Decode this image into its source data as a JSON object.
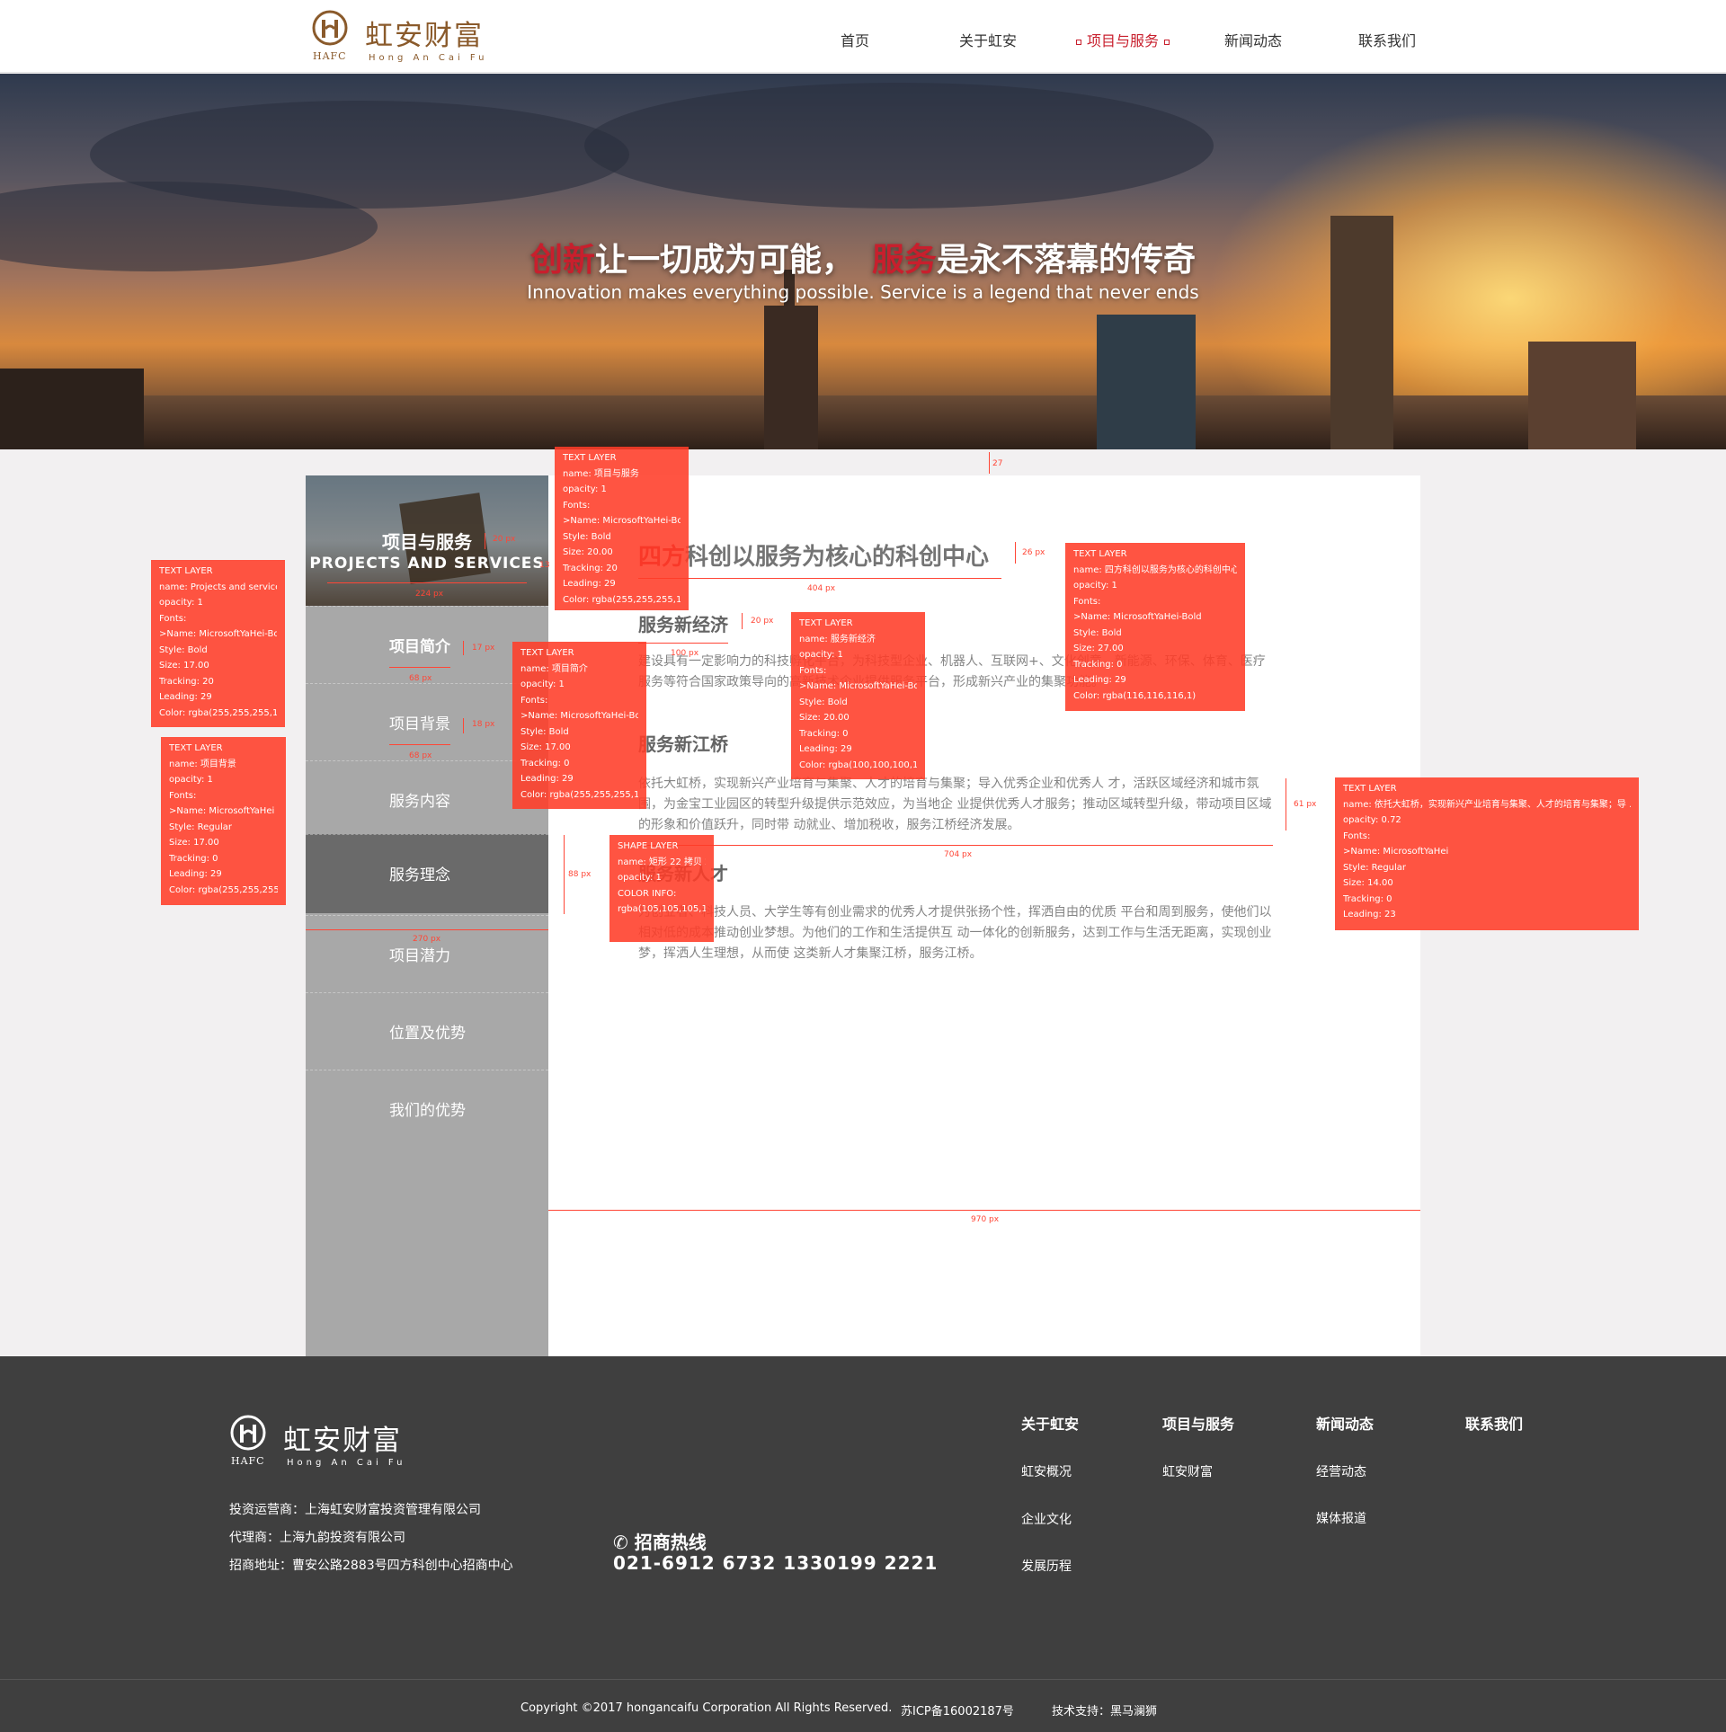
{
  "brand": {
    "name_cn": "虹安财富",
    "name_short": "HAFC",
    "name_pinyin": "Hong An Cai Fu",
    "color": "#8a5a2b"
  },
  "nav": {
    "items": [
      {
        "label": "首页"
      },
      {
        "label": "关于虹安"
      },
      {
        "label": "项目与服务",
        "active": true
      },
      {
        "label": "新闻动态"
      },
      {
        "label": "联系我们"
      }
    ],
    "accent": "#c81f2d"
  },
  "hero": {
    "title_red_1": "创新",
    "title_white_1": "让一切成为可能，",
    "title_red_2": "服务",
    "title_white_2": "是永不落幕的传奇",
    "subtitle": "Innovation makes everything possible. Service is a legend that never ends"
  },
  "sidebar": {
    "title": "项目与服务",
    "subtitle": "PROJECTS AND SERVICES",
    "items": [
      {
        "label": "项目简介"
      },
      {
        "label": "项目背景"
      },
      {
        "label": "服务内容"
      },
      {
        "label": "服务理念",
        "active": true
      },
      {
        "label": "项目潜力"
      },
      {
        "label": "位置及优势"
      },
      {
        "label": "我们的优势"
      }
    ]
  },
  "content": {
    "title_red": "四方",
    "title_rest": "科创以服务为核心的科创中心",
    "sections": [
      {
        "heading": "服务新经济",
        "text": "建设具有一定影响力的科技孵化平台，为科技型企业、机器人、互联网+、文化创意、新能源、环保、体育、医疗服务等符合国家政策导向的高新技术企业提供服务平台，形成新兴产业的集聚功能。"
      },
      {
        "heading": "服务新江桥",
        "text": "依托大虹桥，实现新兴产业培育与集聚、人才的培育与集聚；导入优秀企业和优秀人 才，活跃区域经济和城市氛围，为金宝工业园区的转型升级提供示范效应，为当地企 业提供优秀人才服务；推动区域转型升级，带动项目区域的形象和价值跃升，同时带 动就业、增加税收，服务江桥经济发展。"
      },
      {
        "heading": "服务新人才",
        "text": "为创业者、科技人员、大学生等有创业需求的优秀人才提供张扬个性，挥洒自由的优质 平台和周到服务，使他们以相对低的成本推动创业梦想。为他们的工作和生活提供互 动一体化的创新服务，达到工作与生活无距离，实现创业梦，挥洒人生理想，从而使 这类新人才集聚江桥，服务江桥。"
      }
    ]
  },
  "annotations": [
    {
      "lines": [
        "TEXT LAYER",
        "name: 项目与服务",
        "opacity: 1",
        "Fonts:",
        ">Name: MicrosoftYaHei-Bold",
        "Style: Bold",
        "Size: 20.00",
        "Tracking: 20",
        "Leading: 29",
        "Color: rgba(255,255,255,1)"
      ]
    },
    {
      "lines": [
        "TEXT LAYER",
        "name: 四方科创以服务为核心的科创中心",
        "opacity: 1",
        "Fonts:",
        ">Name: MicrosoftYaHei-Bold",
        "Style: Bold",
        "Size: 27.00",
        "Tracking: 0",
        "Leading: 29",
        "Color: rgba(116,116,116,1)"
      ]
    },
    {
      "lines": [
        "TEXT LAYER",
        "name: Projects and services",
        "opacity: 1",
        "Fonts:",
        ">Name: MicrosoftYaHei-Bold",
        "Style: Bold",
        "Size: 17.00",
        "Tracking: 20",
        "Leading: 29",
        "Color: rgba(255,255,255,1)"
      ]
    },
    {
      "lines": [
        "TEXT LAYER",
        "name: 项目简介",
        "opacity: 1",
        "Fonts:",
        ">Name: MicrosoftYaHei-Bold",
        "Style: Bold",
        "Size: 17.00",
        "Tracking: 0",
        "Leading: 29",
        "Color: rgba(255,255,255,1)"
      ]
    },
    {
      "lines": [
        "TEXT LAYER",
        "name: 服务新经济",
        "opacity: 1",
        "Fonts:",
        ">Name: MicrosoftYaHei-Bold",
        "Style: Bold",
        "Size: 20.00",
        "Tracking: 0",
        "Leading: 29",
        "Color: rgba(100,100,100,1)"
      ]
    },
    {
      "lines": [
        "TEXT LAYER",
        "name: 项目背景",
        "opacity: 1",
        "Fonts:",
        ">Name: MicrosoftYaHei",
        "Style: Regular",
        "Size: 17.00",
        "Tracking: 0",
        "Leading: 29",
        "Color: rgba(255,255,255,1)"
      ]
    },
    {
      "lines": [
        "SHAPE LAYER",
        "name: 矩形 22 拷贝 2",
        "opacity: 1",
        "",
        "COLOR INFO:",
        "rgba(105,105,105,1)"
      ]
    },
    {
      "lines": [
        "TEXT LAYER",
        "name: 依托大虹桥，实现新兴产业培育与集聚、人才的培育与集聚；导 ...",
        "opacity: 0.72",
        "Fonts:",
        ">Name: MicrosoftYaHei",
        "Style: Regular",
        "Size: 14.00",
        "Tracking: 0",
        "Leading: 23"
      ]
    }
  ],
  "measures": {
    "hero_gap": "27",
    "sidebar_title_h": "20 px",
    "sidebar_title_w": "224 px",
    "sidebar_right": "13",
    "title_h": "26 px",
    "title_w": "404 px",
    "h_econ_h": "20 px",
    "h_econ_w": "100 px",
    "item1_h": "17 px",
    "item1_w": "68 px",
    "item2_h": "18 px",
    "item2_w": "68 px",
    "para_h": "61 px",
    "para_w": "704 px",
    "active_h": "88 px",
    "sidebar_w": "270 px",
    "content_w": "970 px"
  },
  "footer": {
    "operator": "投资运营商：上海虹安财富投资管理有限公司",
    "agent": "代理商：上海九韵投资有限公司",
    "address": "招商地址：曹安公路2883号四方科创中心招商中心",
    "hotline_label": "招商热线",
    "hotline_numbers": "021-6912 6732  1330199 2221",
    "cols": [
      {
        "title": "关于虹安",
        "items": [
          "虹安概况",
          "企业文化",
          "发展历程"
        ]
      },
      {
        "title": "项目与服务",
        "items": [
          "虹安财富"
        ]
      },
      {
        "title": "新闻动态",
        "items": [
          "经营动态",
          "媒体报道"
        ]
      },
      {
        "title": "联系我们",
        "items": []
      }
    ],
    "copyright": "Copyright ©2017 hongancaifu Corporation All Rights Reserved.",
    "icp": "苏ICP备16002187号",
    "tech": "技术支持：黑马澜狮"
  }
}
